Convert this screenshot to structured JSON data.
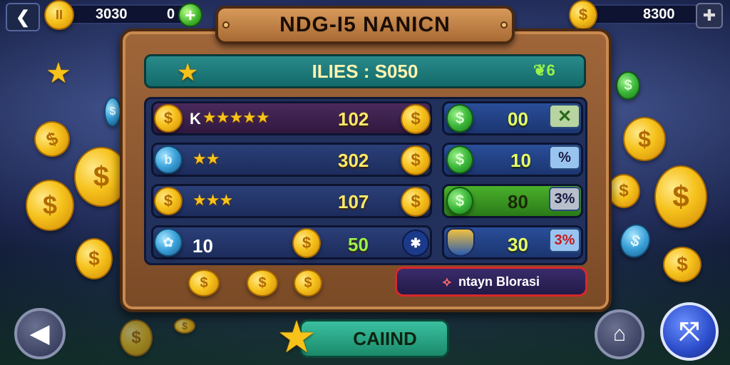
{
  "top_bar": {
    "back_icon": "back-arrow-icon",
    "left_currency": {
      "icon": "coin-icon",
      "value": "3030",
      "secondary": "0",
      "add_icon": "plus-icon"
    },
    "right_currency": {
      "icon": "coin-icon",
      "value": "8300",
      "settings_icon": "puzzle-icon"
    }
  },
  "panel": {
    "title": "NDG-I5 NANICN",
    "header": {
      "text": "ILIES : S050",
      "right_badge": "6"
    },
    "rows": [
      {
        "label": "K",
        "stars": "★★★★★",
        "value": "102"
      },
      {
        "label": "",
        "stars": "★★",
        "value": "302"
      },
      {
        "label": "",
        "stars": "★★★",
        "value": "107"
      },
      {
        "label": "10",
        "stars": "",
        "value": "50"
      }
    ],
    "side_rows": [
      {
        "value": "00",
        "tag": "✕"
      },
      {
        "value": "10",
        "tag": "%"
      },
      {
        "value": "80",
        "tag": "3%"
      },
      {
        "value": "30",
        "tag": "3%"
      }
    ],
    "bonus_button": {
      "label": "ntayn Blorasi"
    }
  },
  "bottom": {
    "casino_label": "CAIIND",
    "left_button_icon": "back-icon",
    "home_button_icon": "home-icon",
    "right_button_icon": "swap-icon"
  },
  "colors": {
    "gold": "#f6c21c",
    "wood": "#8a5430",
    "teal": "#1a8a8a",
    "navy": "#22305c",
    "green": "#3cb83a",
    "red": "#d8282a"
  }
}
